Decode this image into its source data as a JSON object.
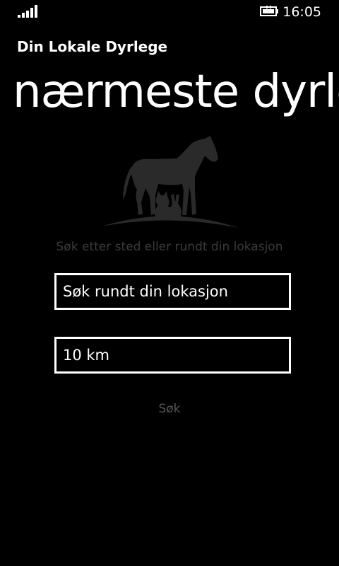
{
  "status_bar": {
    "time": "16:05",
    "signal_icon": "signal-strength-icon",
    "battery_icon": "battery-charging-icon"
  },
  "app": {
    "title": "Din Lokale Dyrlege"
  },
  "page": {
    "title": "nærmeste dyrlege"
  },
  "logo": {
    "icon": "horse-cat-rabbit-logo-icon"
  },
  "search": {
    "hint": "Søk etter sted eller rundt din lokasjon",
    "location_value": "Søk rundt din lokasjon",
    "radius_value": "10 km",
    "button_label": "Søk"
  },
  "colors": {
    "background": "#000000",
    "text": "#ffffff",
    "hint": "#3a3a3a",
    "button_disabled": "#555555",
    "logo": "#2a2a2a"
  }
}
